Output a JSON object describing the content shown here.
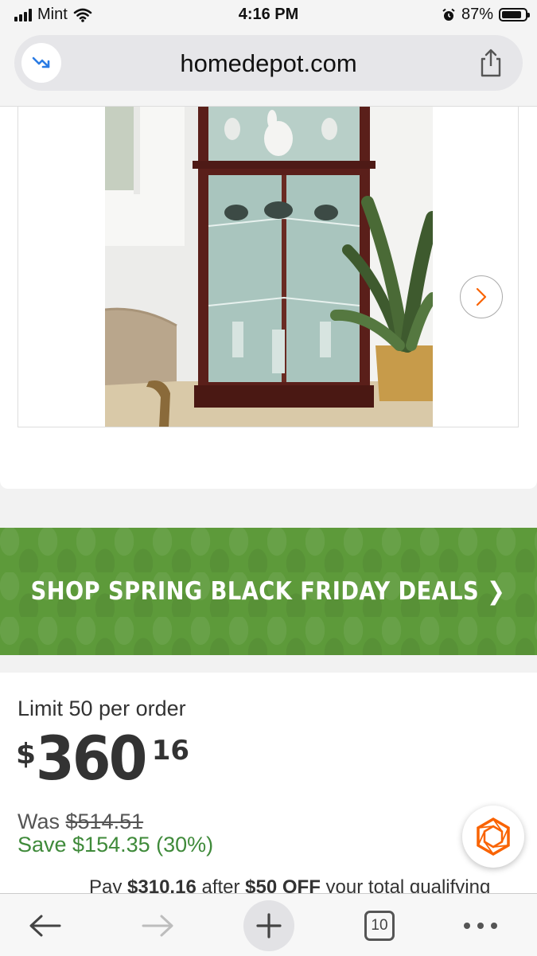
{
  "status_bar": {
    "carrier": "Mint",
    "time": "4:16 PM",
    "battery": "87%"
  },
  "browser": {
    "url": "homedepot.com",
    "tab_count": "10"
  },
  "gallery": {
    "active_index": 1,
    "total_dots": 3,
    "icons": [
      "chevron-right-icon"
    ]
  },
  "banner": {
    "text": "SHOP SPRING BLACK FRIDAY DEALS ❯",
    "color": "#5d9a3a"
  },
  "product": {
    "limit_text": "Limit 50 per order",
    "price_currency": "$",
    "price_dollars": "360",
    "price_cents": "16",
    "was_label": "Was",
    "was_price": "$514.51",
    "save_text": "Save $154.35 (30%)",
    "pay_prefix": "Pay",
    "pay_amount": "$310.16",
    "pay_middle": "after",
    "pay_discount": "$50 OFF",
    "pay_suffix": "your total qualifying"
  },
  "colors": {
    "brand_orange": "#f96302",
    "save_green": "#3f8a3a"
  }
}
